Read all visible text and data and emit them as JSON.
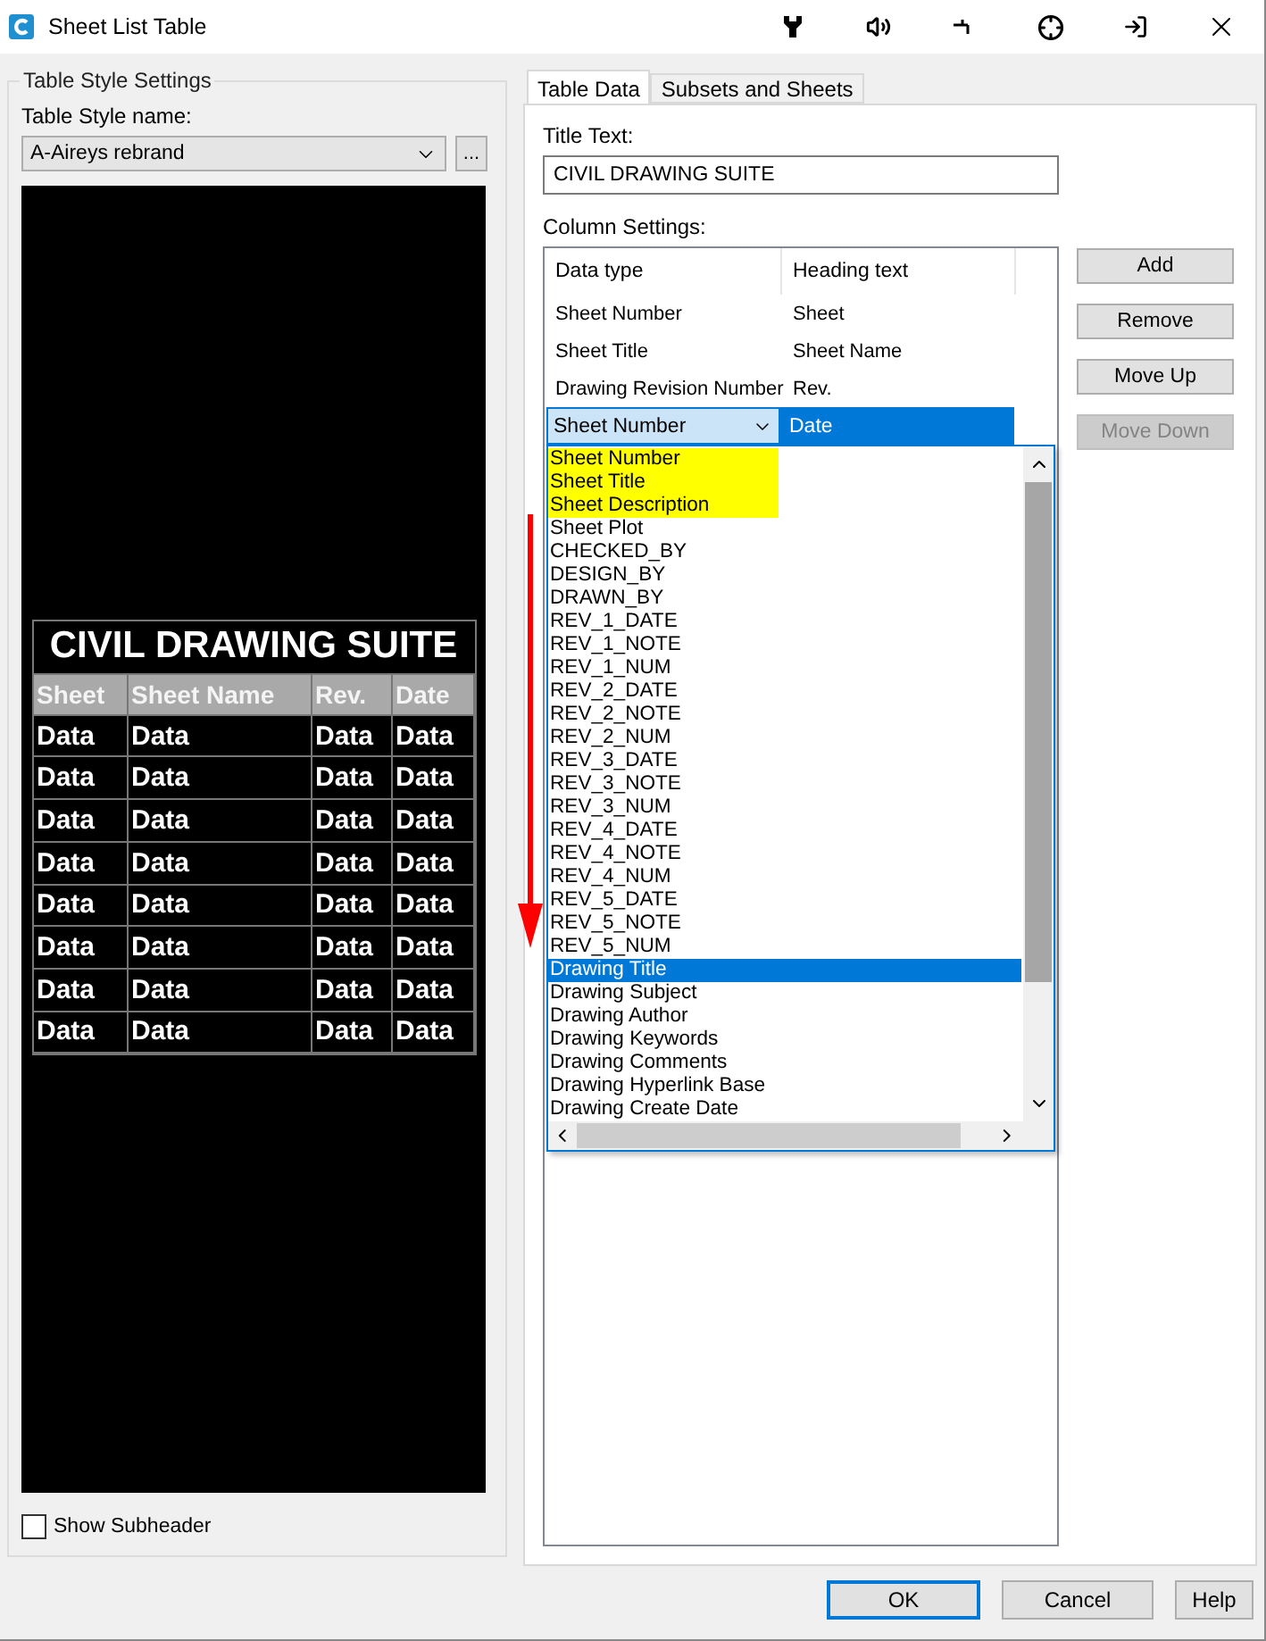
{
  "window": {
    "title": "Sheet List Table"
  },
  "style_settings": {
    "group_title": "Table Style Settings",
    "name_label": "Table Style name:",
    "name_value": "A-Aireys rebrand",
    "browse_button": "...",
    "preview": {
      "title": "CIVIL DRAWING SUITE",
      "headers": [
        "Sheet",
        "Sheet Name",
        "Rev.",
        "Date"
      ],
      "rows": [
        [
          "Data",
          "Data",
          "Data",
          "Data"
        ],
        [
          "Data",
          "Data",
          "Data",
          "Data"
        ],
        [
          "Data",
          "Data",
          "Data",
          "Data"
        ],
        [
          "Data",
          "Data",
          "Data",
          "Data"
        ],
        [
          "Data",
          "Data",
          "Data",
          "Data"
        ],
        [
          "Data",
          "Data",
          "Data",
          "Data"
        ],
        [
          "Data",
          "Data",
          "Data",
          "Data"
        ],
        [
          "Data",
          "Data",
          "Data",
          "Data"
        ]
      ]
    },
    "show_subheader": {
      "label": "Show Subheader",
      "checked": false
    }
  },
  "tabs": [
    {
      "label": "Table Data",
      "selected": true
    },
    {
      "label": "Subsets and Sheets",
      "selected": false
    }
  ],
  "title_text": {
    "label": "Title Text:",
    "value": "CIVIL DRAWING SUITE"
  },
  "column_settings": {
    "label": "Column Settings:",
    "columns": [
      "Data type",
      "Heading text"
    ],
    "rows": [
      {
        "data_type": "Sheet Number",
        "heading": "Sheet"
      },
      {
        "data_type": "Sheet Title",
        "heading": "Sheet Name"
      },
      {
        "data_type": "Drawing Revision Number",
        "heading": "Rev."
      }
    ],
    "edit_row": {
      "data_type": "Sheet Number",
      "heading": "Date"
    },
    "dropdown": [
      {
        "label": "Sheet Number",
        "highlighted": true,
        "selected": false
      },
      {
        "label": "Sheet Title",
        "highlighted": true,
        "selected": false
      },
      {
        "label": "Sheet Description",
        "highlighted": true,
        "selected": false
      },
      {
        "label": "Sheet Plot",
        "highlighted": false,
        "selected": false
      },
      {
        "label": "CHECKED_BY",
        "highlighted": false,
        "selected": false
      },
      {
        "label": "DESIGN_BY",
        "highlighted": false,
        "selected": false
      },
      {
        "label": "DRAWN_BY",
        "highlighted": false,
        "selected": false
      },
      {
        "label": "REV_1_DATE",
        "highlighted": false,
        "selected": false
      },
      {
        "label": "REV_1_NOTE",
        "highlighted": false,
        "selected": false
      },
      {
        "label": "REV_1_NUM",
        "highlighted": false,
        "selected": false
      },
      {
        "label": "REV_2_DATE",
        "highlighted": false,
        "selected": false
      },
      {
        "label": "REV_2_NOTE",
        "highlighted": false,
        "selected": false
      },
      {
        "label": "REV_2_NUM",
        "highlighted": false,
        "selected": false
      },
      {
        "label": "REV_3_DATE",
        "highlighted": false,
        "selected": false
      },
      {
        "label": "REV_3_NOTE",
        "highlighted": false,
        "selected": false
      },
      {
        "label": "REV_3_NUM",
        "highlighted": false,
        "selected": false
      },
      {
        "label": "REV_4_DATE",
        "highlighted": false,
        "selected": false
      },
      {
        "label": "REV_4_NOTE",
        "highlighted": false,
        "selected": false
      },
      {
        "label": "REV_4_NUM",
        "highlighted": false,
        "selected": false
      },
      {
        "label": "REV_5_DATE",
        "highlighted": false,
        "selected": false
      },
      {
        "label": "REV_5_NOTE",
        "highlighted": false,
        "selected": false
      },
      {
        "label": "REV_5_NUM",
        "highlighted": false,
        "selected": false
      },
      {
        "label": "Drawing Title",
        "highlighted": false,
        "selected": true
      },
      {
        "label": "Drawing Subject",
        "highlighted": false,
        "selected": false
      },
      {
        "label": "Drawing Author",
        "highlighted": false,
        "selected": false
      },
      {
        "label": "Drawing Keywords",
        "highlighted": false,
        "selected": false
      },
      {
        "label": "Drawing Comments",
        "highlighted": false,
        "selected": false
      },
      {
        "label": "Drawing Hyperlink Base",
        "highlighted": false,
        "selected": false
      },
      {
        "label": "Drawing Create Date",
        "highlighted": false,
        "selected": false
      }
    ]
  },
  "side_buttons": [
    {
      "label": "Add",
      "disabled": false
    },
    {
      "label": "Remove",
      "disabled": false
    },
    {
      "label": "Move Up",
      "disabled": false
    },
    {
      "label": "Move Down",
      "disabled": true
    }
  ],
  "footer_buttons": [
    {
      "label": "OK",
      "default": true
    },
    {
      "label": "Cancel",
      "default": false
    },
    {
      "label": "Help",
      "default": false
    }
  ]
}
